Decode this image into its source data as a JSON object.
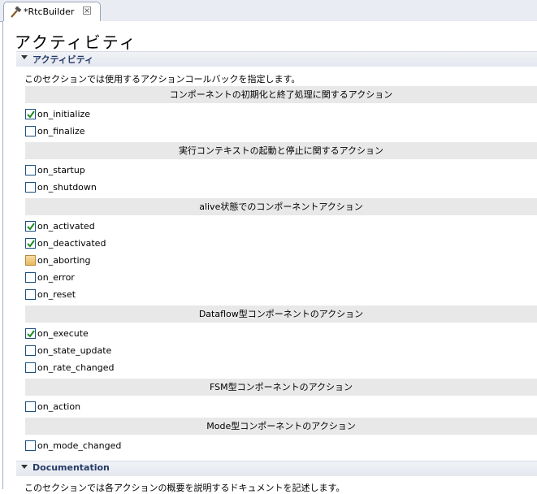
{
  "tab": {
    "label": "*RtcBuilder",
    "icon": "hammer-icon",
    "close_icon": "close-icon"
  },
  "page_title": "アクティビティ",
  "section": {
    "title": "アクティビティ",
    "description": "このセクションでは使用するアクションコールバックを指定します。"
  },
  "groups": [
    {
      "title": "コンポーネントの初期化と終了処理に関するアクション",
      "items": [
        {
          "label": "on_initialize",
          "state": "checked"
        },
        {
          "label": "on_finalize",
          "state": "unchecked"
        }
      ]
    },
    {
      "title": "実行コンテキストの起動と停止に関するアクション",
      "items": [
        {
          "label": "on_startup",
          "state": "unchecked"
        },
        {
          "label": "on_shutdown",
          "state": "unchecked"
        }
      ]
    },
    {
      "title": "alive状態でのコンポーネントアクション",
      "items": [
        {
          "label": "on_activated",
          "state": "checked"
        },
        {
          "label": "on_deactivated",
          "state": "checked"
        },
        {
          "label": "on_aborting",
          "state": "partial"
        },
        {
          "label": "on_error",
          "state": "unchecked"
        },
        {
          "label": "on_reset",
          "state": "unchecked"
        }
      ]
    },
    {
      "title": "Dataflow型コンポーネントのアクション",
      "items": [
        {
          "label": "on_execute",
          "state": "checked"
        },
        {
          "label": "on_state_update",
          "state": "unchecked"
        },
        {
          "label": "on_rate_changed",
          "state": "unchecked"
        }
      ]
    },
    {
      "title": "FSM型コンポーネントのアクション",
      "items": [
        {
          "label": "on_action",
          "state": "unchecked"
        }
      ]
    },
    {
      "title": "Mode型コンポーネントのアクション",
      "items": [
        {
          "label": "on_mode_changed",
          "state": "unchecked"
        }
      ]
    }
  ],
  "documentation": {
    "title": "Documentation",
    "description": "このセクションでは各アクションの概要を説明するドキュメントを記述します。"
  },
  "colors": {
    "section_title": "#253a67",
    "check": "#1e8a1e",
    "group_bar": "#e8e8e8"
  }
}
